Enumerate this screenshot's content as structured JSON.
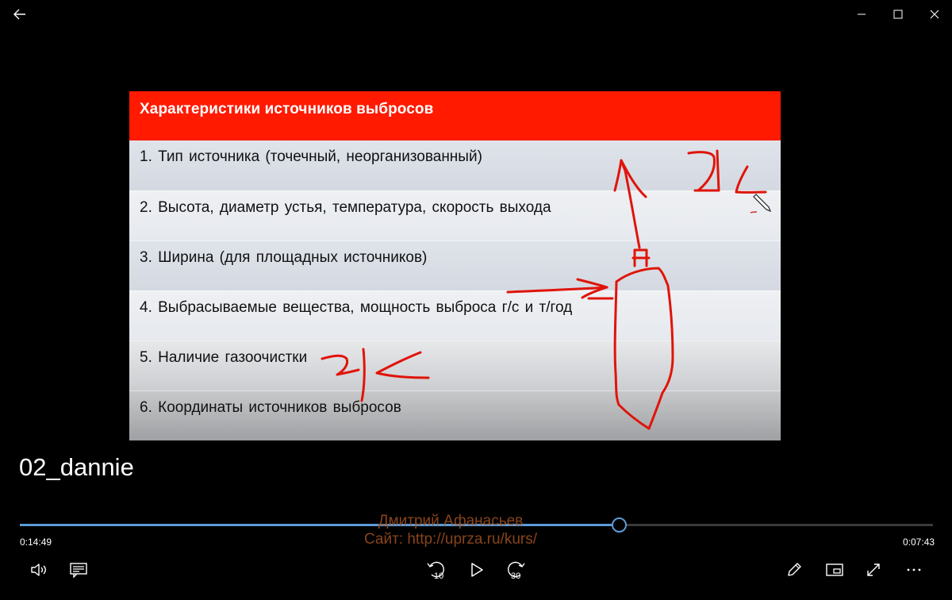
{
  "window": {
    "back_icon": "back-arrow-icon",
    "minimize_icon": "minimize-icon",
    "maximize_icon": "maximize-icon",
    "close_icon": "close-icon"
  },
  "slide": {
    "title": "Характеристики источников выбросов",
    "header_color": "#ff1a00",
    "rows": [
      "1. Тип источника  (точечный,  неорганизованный)",
      "2. Высота,  диаметр  устья,  температура,  скорость  выхода",
      "3. Ширина (для площадных  источников)",
      "4. Выбрасываемые  вещества,  мощность  выброса  г/с и т/год",
      "5. Наличие  газоочистки",
      "6. Координаты  источников  выбросов"
    ],
    "annotation_color": "#e0140a"
  },
  "player": {
    "video_title": "02_dannie",
    "watermark_line1": "Дмитрий Афанасьев",
    "watermark_line2": "Сайт: http://uprza.ru/kurs/",
    "time_elapsed": "0:14:49",
    "time_remaining": "0:07:43",
    "progress_fraction": 0.656,
    "accent_color": "#5d9bd8",
    "skip_back_label": "10",
    "skip_forward_label": "30"
  }
}
